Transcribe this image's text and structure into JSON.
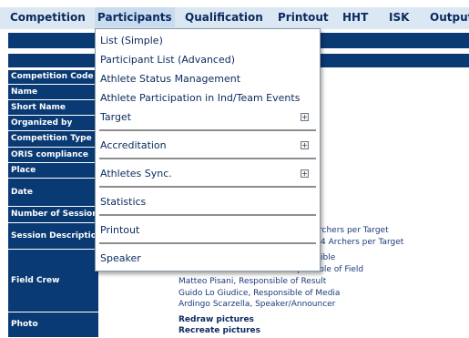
{
  "menubar": {
    "items": [
      "Competition",
      "Participants",
      "Qualification",
      "Printout",
      "HHT",
      "ISK",
      "Output"
    ],
    "active": "Participants"
  },
  "labels": {
    "competition_code": "Competition Code",
    "name": "Name",
    "short_name": "Short Name",
    "organized_by": "Organized by",
    "competition_type": "Competition Type",
    "oris_compliance": "ORIS compliance",
    "place": "Place",
    "date": "Date",
    "number_of_sessions": "Number of Sessions",
    "session_description": "Session Description",
    "field_crew": "Field Crew",
    "photo": "Photo"
  },
  "values": {
    "session_line1": "rchers per Target",
    "session_line2": "4 Archers per Target",
    "crew_line1": "ible",
    "crew_line2": "Responsible of Field",
    "crew_line3": "Matteo Pisani, Responsible of Result",
    "crew_line4": "Guido Lo Giudice, Responsible of Media",
    "crew_line5": "Ardingo Scarzella, Speaker/Announcer",
    "photo_line1": "Redraw pictures",
    "photo_line2": "Recreate pictures"
  },
  "dropdown": {
    "list_simple": "List (Simple)",
    "participant_list_advanced": "Participant List (Advanced)",
    "athlete_status_management": "Athlete Status Management",
    "athlete_participation": "Athlete Participation in Ind/Team Events",
    "target": "Target",
    "accreditation": "Accreditation",
    "athletes_sync": "Athletes Sync.",
    "statistics": "Statistics",
    "printout": "Printout",
    "speaker": "Speaker",
    "expand_icon_glyph": "+"
  },
  "colors": {
    "header_blue": "#0a3a74",
    "menubar_bg": "#dbe7f3",
    "menu_text": "#0a2a5e"
  }
}
